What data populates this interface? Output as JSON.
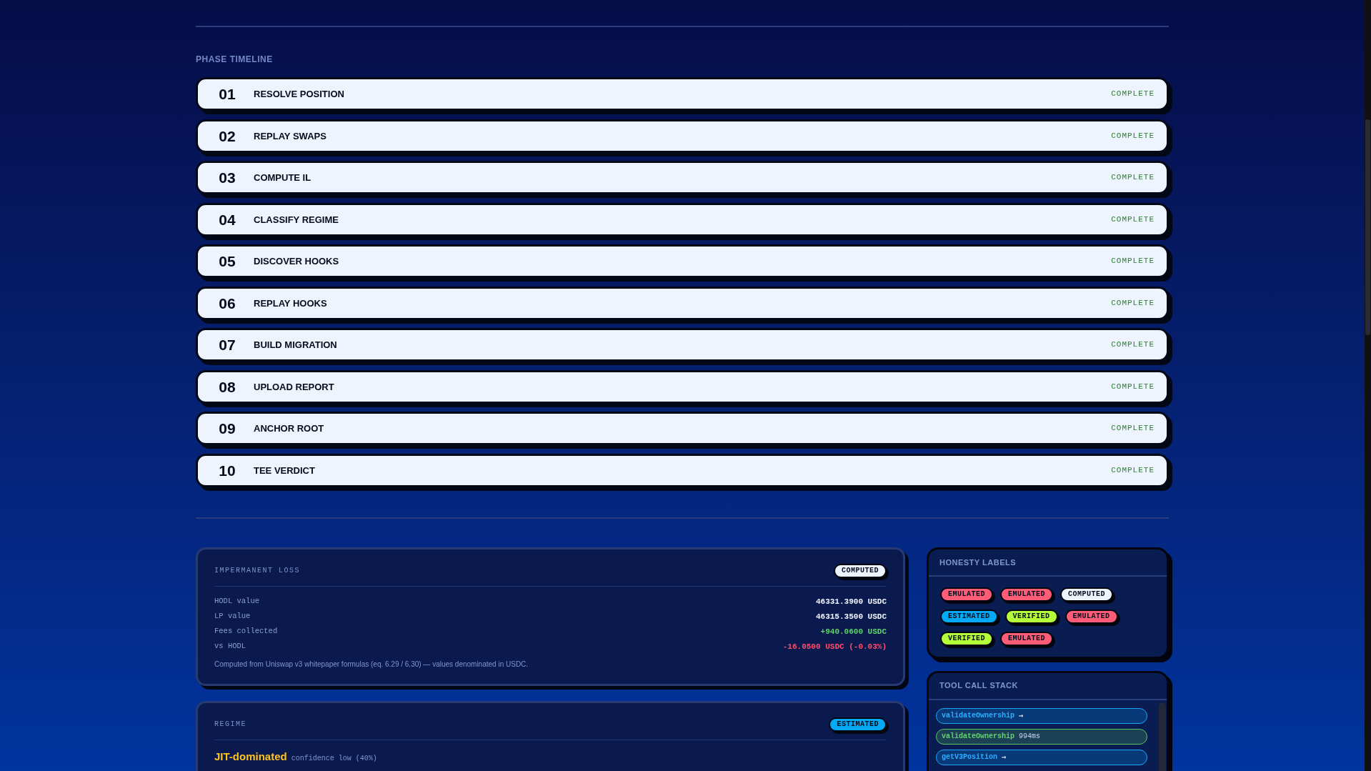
{
  "phase_timeline": {
    "heading": "PHASE TIMELINE",
    "phases": [
      {
        "number": "01",
        "title": "RESOLVE POSITION",
        "status": "COMPLETE"
      },
      {
        "number": "02",
        "title": "REPLAY SWAPS",
        "status": "COMPLETE"
      },
      {
        "number": "03",
        "title": "COMPUTE IL",
        "status": "COMPLETE"
      },
      {
        "number": "04",
        "title": "CLASSIFY REGIME",
        "status": "COMPLETE"
      },
      {
        "number": "05",
        "title": "DISCOVER HOOKS",
        "status": "COMPLETE"
      },
      {
        "number": "06",
        "title": "REPLAY HOOKS",
        "status": "COMPLETE"
      },
      {
        "number": "07",
        "title": "BUILD MIGRATION",
        "status": "COMPLETE"
      },
      {
        "number": "08",
        "title": "UPLOAD REPORT",
        "status": "COMPLETE"
      },
      {
        "number": "09",
        "title": "ANCHOR ROOT",
        "status": "COMPLETE"
      },
      {
        "number": "10",
        "title": "TEE VERDICT",
        "status": "COMPLETE"
      }
    ]
  },
  "impermanent_loss": {
    "title": "IMPERMANENT LOSS",
    "badge": {
      "label": "COMPUTED",
      "kind": "computed"
    },
    "rows": [
      {
        "label": "HODL value",
        "value": "46331.3900 USDC",
        "color": "#f3f6ff"
      },
      {
        "label": "LP value",
        "value": "46315.3500 USDC",
        "color": "#f3f6ff"
      },
      {
        "label": "Fees collected",
        "value": "+940.0600 USDC",
        "color": "#5fd36a"
      },
      {
        "label": "vs HODL",
        "value": "-16.0500 USDC (-0.03%)",
        "color": "#ff4d6a"
      }
    ],
    "note": "Computed from Uniswap v3 whitepaper formulas (eq. 6.29 / 6.30) — values denominated in USDC."
  },
  "regime": {
    "title": "REGIME",
    "badge": {
      "label": "ESTIMATED",
      "kind": "estimated"
    },
    "classification": "JIT-dominated",
    "confidence": "confidence low (40%)"
  },
  "honesty_labels": {
    "title": "HONESTY LABELS",
    "labels": [
      {
        "label": "EMULATED",
        "kind": "emulated"
      },
      {
        "label": "EMULATED",
        "kind": "emulated"
      },
      {
        "label": "COMPUTED",
        "kind": "computed"
      },
      {
        "label": "ESTIMATED",
        "kind": "estimated"
      },
      {
        "label": "VERIFIED",
        "kind": "verified"
      },
      {
        "label": "EMULATED",
        "kind": "emulated"
      },
      {
        "label": "VERIFIED",
        "kind": "verified"
      },
      {
        "label": "EMULATED",
        "kind": "emulated"
      }
    ]
  },
  "tool_call_stack": {
    "title": "TOOL CALL STACK",
    "calls": [
      {
        "name": "validateOwnership",
        "completed": false,
        "arrow": "→"
      },
      {
        "name": "validateOwnership",
        "completed": true,
        "duration": "994ms"
      },
      {
        "name": "getV3Position",
        "completed": false,
        "arrow": "→"
      }
    ]
  }
}
